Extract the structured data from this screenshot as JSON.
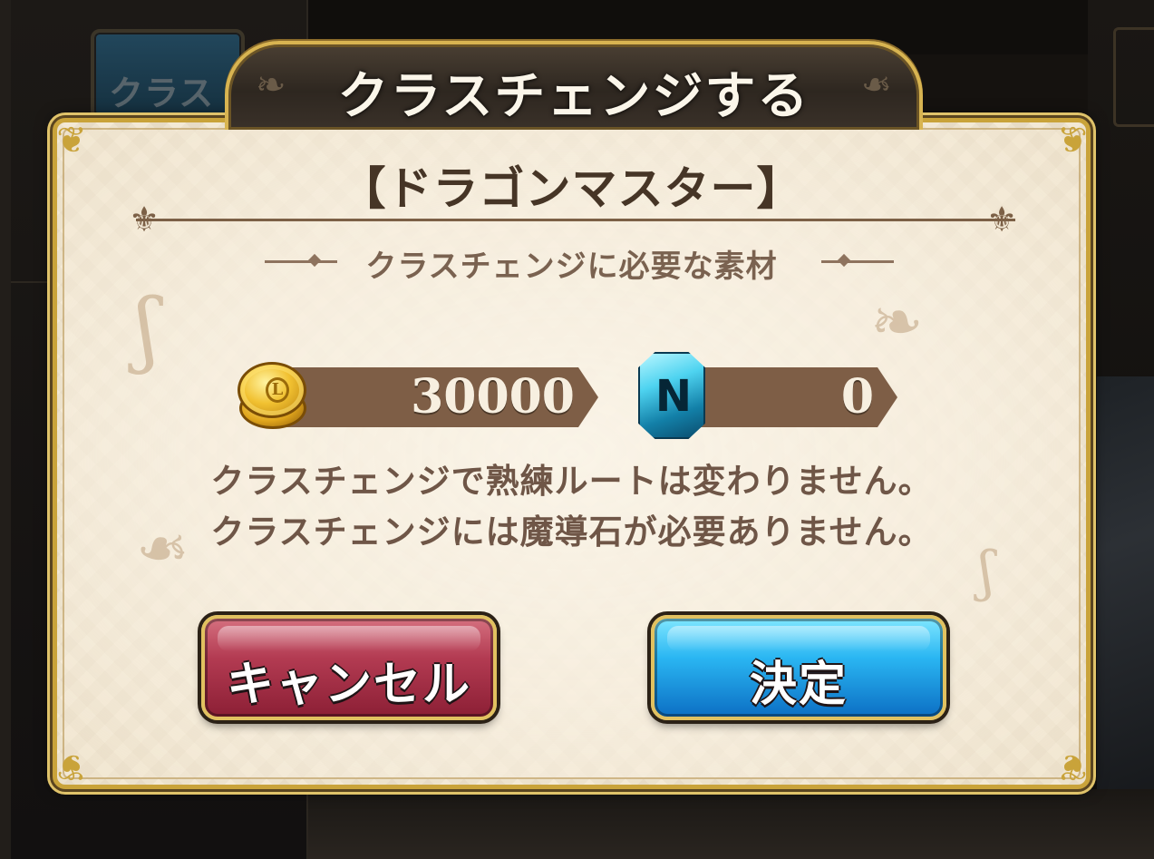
{
  "background": {
    "tab_label": "クラス"
  },
  "dialog": {
    "title": "クラスチェンジする",
    "class_name": "【ドラゴンマスター】",
    "materials_heading": "クラスチェンジに必要な素材",
    "costs": [
      {
        "icon": "gold-coin-icon",
        "value": "30000"
      },
      {
        "icon": "magic-stone-icon",
        "value": "0"
      }
    ],
    "notes": [
      "クラスチェンジで熟練ルートは変わりません。",
      "クラスチェンジには魔導石が必要ありません。"
    ],
    "buttons": {
      "cancel": "キャンセル",
      "confirm": "決定"
    }
  },
  "colors": {
    "panel": "#f3e9d5",
    "gold_border": "#c9a33a",
    "cost_bar": "#7e5e46",
    "cancel_button": "#b33b52",
    "confirm_button": "#2ab6f2"
  }
}
